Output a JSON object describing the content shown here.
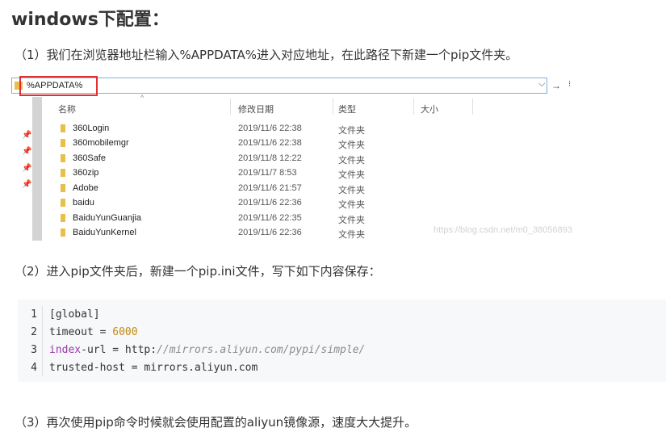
{
  "title": "windows下配置：",
  "paragraphs": {
    "p1": "（1）我们在浏览器地址栏输入%APPDATA%进入对应地址，在此路径下新建一个pip文件夹。",
    "p2": "（2）进入pip文件夹后，新建一个pip.ini文件，写下如下内容保存：",
    "p3": "（3）再次使用pip命令时候就会使用配置的aliyun镜像源，速度大大提升。"
  },
  "explorer": {
    "address": "%APPDATA%",
    "columns": {
      "name": "名称",
      "date": "修改日期",
      "type": "类型",
      "size": "大小"
    },
    "rows": [
      {
        "name": "360Login",
        "date": "2019/11/6 22:38",
        "type": "文件夹"
      },
      {
        "name": "360mobilemgr",
        "date": "2019/11/6 22:38",
        "type": "文件夹"
      },
      {
        "name": "360Safe",
        "date": "2019/11/8 12:22",
        "type": "文件夹"
      },
      {
        "name": "360zip",
        "date": "2019/11/7 8:53",
        "type": "文件夹"
      },
      {
        "name": "Adobe",
        "date": "2019/11/6 21:57",
        "type": "文件夹"
      },
      {
        "name": "baidu",
        "date": "2019/11/6 22:36",
        "type": "文件夹"
      },
      {
        "name": "BaiduYunGuanjia",
        "date": "2019/11/6 22:35",
        "type": "文件夹"
      },
      {
        "name": "BaiduYunKernel",
        "date": "2019/11/6 22:36",
        "type": "文件夹"
      }
    ],
    "watermark": "https://blog.csdn.net/m0_38056893"
  },
  "code": {
    "line_numbers": [
      "1",
      "2",
      "3",
      "4"
    ],
    "l1": "[global]",
    "l2_key": "timeout = ",
    "l2_val": "6000",
    "l3_kw": "index",
    "l3_mid": "-url = http:",
    "l3_rest": "//mirrors.aliyun.com/pypi/simple/",
    "l4": "trusted-host = mirrors.aliyun.com"
  },
  "icons": [
    "folder-icon",
    "pin-icon",
    "chevron-down-icon",
    "arrow-right-icon"
  ],
  "colors": {
    "highlight_border": "#e03030",
    "folder": "#e7bf4a",
    "code_number": "#c08a12",
    "code_keyword": "#9b39a8"
  }
}
